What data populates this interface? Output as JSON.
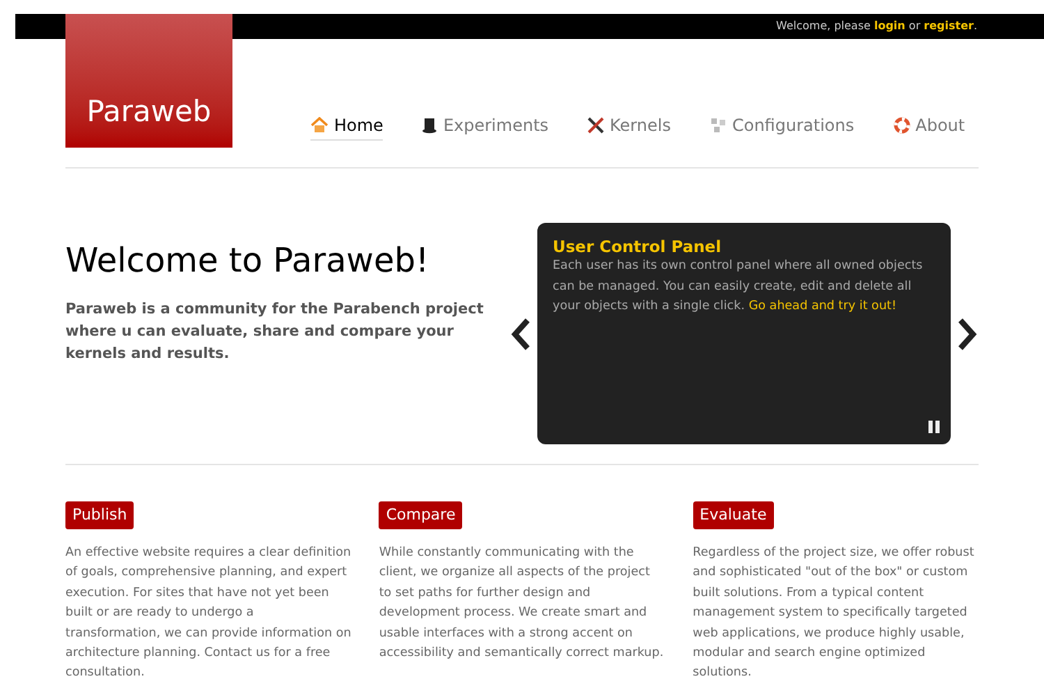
{
  "top_bar": {
    "greeting": "Welcome, please",
    "login": "login",
    "separator": "or",
    "register": "register",
    "end": "."
  },
  "logo": "Paraweb",
  "nav": [
    {
      "label": "Home",
      "selected": true
    },
    {
      "label": "Experiments",
      "selected": false
    },
    {
      "label": "Kernels",
      "selected": false
    },
    {
      "label": "Configurations",
      "selected": false
    },
    {
      "label": "About",
      "selected": false
    }
  ],
  "hero": {
    "title": "Welcome to Paraweb!",
    "lead": "Paraweb is a community for the Parabench project where u can evaluate, share and compare your kernels and results."
  },
  "slide": {
    "title": "User Control Panel",
    "text": "Each user has its own control panel where all owned objects can be managed. You can easily create, edit and delete all your objects with a single click.",
    "link": "Go ahead and try it out!"
  },
  "features": [
    {
      "title": "Publish",
      "text": "An effective website requires a clear definition of goals, comprehensive planning, and expert execution. For sites that have not yet been built or are ready to undergo a transformation, we can provide information on architecture planning. Contact us for a free consultation."
    },
    {
      "title": "Compare",
      "text": "While constantly communicating with the client, we organize all aspects of the project to set paths for further design and development process. We create smart and usable interfaces with a strong accent on accessibility and semantically correct markup."
    },
    {
      "title": "Evaluate",
      "text": "Regardless of the project size, we offer robust and sophisticated \"out of the box\" or custom built solutions. From a typical content management system to specifically targeted web applications, we produce highly usable, modular and search engine optimized solutions."
    }
  ]
}
